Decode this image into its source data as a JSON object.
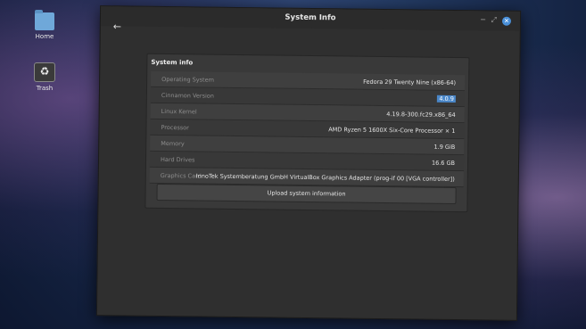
{
  "desktop": {
    "icons": [
      {
        "label": "Home",
        "icon": "folder-icon"
      },
      {
        "label": "Trash",
        "icon": "trash-icon"
      }
    ]
  },
  "window": {
    "title": "System Info",
    "back_icon": "←",
    "minimize_icon": "−",
    "maximize_icon": "⤢",
    "close_icon": "✕"
  },
  "panel": {
    "title": "System info",
    "rows": [
      {
        "label": "Operating System",
        "value": "Fedora 29 Twenty Nine (x86-64)"
      },
      {
        "label": "Cinnamon Version",
        "value": "4.0.9"
      },
      {
        "label": "Linux Kernel",
        "value": "4.19.8-300.fc29.x86_64"
      },
      {
        "label": "Processor",
        "value": "AMD Ryzen 5 1600X Six-Core Processor × 1"
      },
      {
        "label": "Memory",
        "value": "1.9 GiB"
      },
      {
        "label": "Hard Drives",
        "value": "16.6 GB"
      },
      {
        "label": "Graphics Card",
        "value": "InnoTek Systemberatung GmbH VirtualBox Graphics Adapter (prog-if 00 [VGA controller])"
      }
    ],
    "upload_label": "Upload system information"
  },
  "colors": {
    "accent": "#4a87c9",
    "window_bg": "#2f2f2f",
    "panel_bg": "#393939"
  }
}
